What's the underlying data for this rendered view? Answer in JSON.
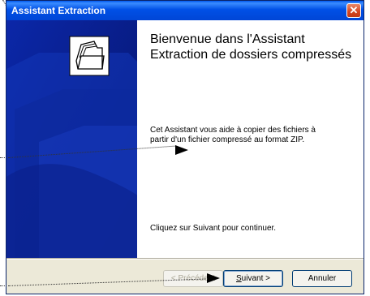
{
  "window": {
    "title": "Assistant Extraction",
    "close_symbol": "✕"
  },
  "content": {
    "heading": "Bienvenue dans l'Assistant Extraction de dossiers compressés",
    "description": "Cet Assistant vous aide à copier des fichiers à partir d'un fichier compressé au format ZIP.",
    "continue_hint": "Cliquez sur Suivant pour continuer."
  },
  "buttons": {
    "back": "< Précédent",
    "next_prefix": "",
    "next_underlined": "S",
    "next_rest": "uivant >",
    "cancel": "Annuler"
  },
  "colors": {
    "titlebar": "#0050e6",
    "sidebar": "#0a1f8a",
    "dialog_bg": "#ece9d8"
  },
  "icons": {
    "wizard_icon": "folder-stack-icon",
    "close": "close-icon",
    "cursor": "arrow-cursor-icon"
  }
}
